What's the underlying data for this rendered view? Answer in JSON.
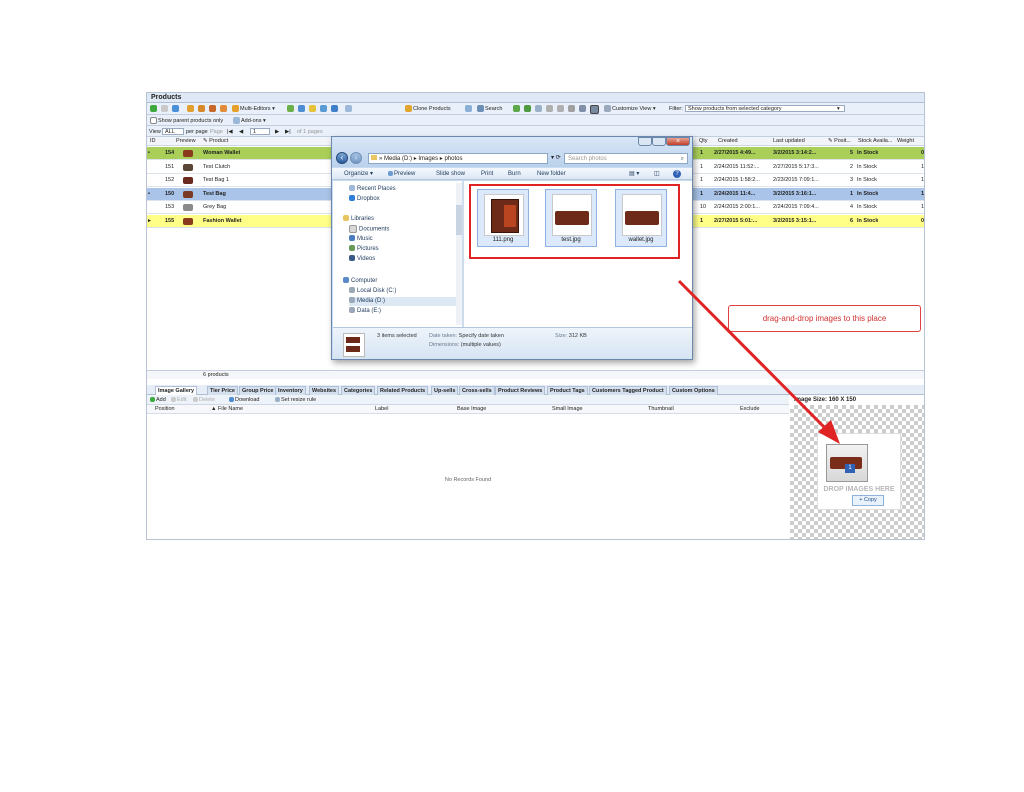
{
  "app": {
    "title": "Products",
    "toolbar1": {
      "multi_editors": "Multi-Editors",
      "clone_products": "Clone Products",
      "search": "Search",
      "customize_view": "Customize View",
      "filter_label": "Filter:",
      "filter_value": "Show products from selected category"
    },
    "toolbar2": {
      "show_parent": "Show parent products only",
      "addons": "Add-ons"
    },
    "toolbar3": {
      "view_label": "View",
      "view_value": "ALL",
      "per_page": "per page",
      "page_label": "Page",
      "page_value": "1",
      "of_pages": "of 1 pages"
    },
    "columns": {
      "id": "ID",
      "preview": "Preview",
      "product": "Product",
      "qty": "Qty",
      "created": "Created",
      "last_updated": "Last updated",
      "position": "Posit...",
      "stock": "Stock Availa...",
      "weight": "Weight"
    },
    "rows": [
      {
        "id": "154",
        "name": "Woman Wallet",
        "qty": "1",
        "created": "2/27/2015 4:49...",
        "updated": "3/2/2015 3:14:2...",
        "pos": "5",
        "stock": "In Stock",
        "weight": "0",
        "kind": "parent",
        "thumb": "#8b3a1e"
      },
      {
        "id": "151",
        "name": "Test Clutch",
        "qty": "1",
        "created": "2/24/2015 11:52:...",
        "updated": "2/27/2015 5:17:3...",
        "pos": "2",
        "stock": "In Stock",
        "weight": "1",
        "kind": "child",
        "thumb": "#5a4636"
      },
      {
        "id": "152",
        "name": "Test Bag 1",
        "qty": "1",
        "created": "2/24/2015 1:58:2...",
        "updated": "2/23/2015 7:09:1...",
        "pos": "3",
        "stock": "In Stock",
        "weight": "1",
        "kind": "child",
        "thumb": "#6b2a20"
      },
      {
        "id": "150",
        "name": "Test Bag",
        "qty": "1",
        "created": "2/24/2015 11:4...",
        "updated": "3/2/2015 3:16:1...",
        "pos": "1",
        "stock": "In Stock",
        "weight": "1",
        "kind": "parent-blue",
        "thumb": "#7a3a25"
      },
      {
        "id": "153",
        "name": "Grey Bag",
        "qty": "10",
        "created": "2/24/2015 2:00:1...",
        "updated": "2/24/2015 7:09:4...",
        "pos": "4",
        "stock": "In Stock",
        "weight": "1",
        "kind": "child",
        "thumb": "#8a8a8a"
      },
      {
        "id": "155",
        "name": "Fashion Wallet",
        "qty": "1",
        "created": "2/27/2015 5:01:...",
        "updated": "3/2/2015 3:15:1...",
        "pos": "6",
        "stock": "In Stock",
        "weight": "0",
        "kind": "selected",
        "thumb": "#8b3a1e"
      }
    ],
    "status": "6 products",
    "tabs": [
      "Image Gallery",
      "Tier Price",
      "Group Price",
      "Inventory",
      "Websites",
      "Categories",
      "Related Products",
      "Up-sells",
      "Cross-sells",
      "Product Reviews",
      "Product Tags",
      "Customers Tagged Product",
      "Custom Options"
    ],
    "image_toolbar": {
      "add": "Add",
      "edit": "Edit",
      "delete": "Delete",
      "download": "Download",
      "resize": "Set resize rule"
    },
    "image_columns": [
      "Position",
      "File Name",
      "Label",
      "Base Image",
      "Small Image",
      "Thumbnail",
      "Exclude"
    ],
    "no_records": "No Records Found",
    "image_size": "Image Size: 160 X 150",
    "drop_text": "DROP IMAGES HERE",
    "drag_badge": "1",
    "copy_label": "+ Copy"
  },
  "explorer": {
    "address": [
      "Media (D:)",
      "Images",
      "photos"
    ],
    "search_placeholder": "Search photos",
    "commands": [
      "Organize",
      "Preview",
      "Slide show",
      "Print",
      "Burn",
      "New folder"
    ],
    "nav": {
      "favorites": [
        "Recent Places",
        "Dropbox"
      ],
      "libraries_label": "Libraries",
      "libraries": [
        "Documents",
        "Music",
        "Pictures",
        "Videos"
      ],
      "computer_label": "Computer",
      "drives": [
        "Local Disk (C:)",
        "Media (D:)",
        "Data (E:)"
      ]
    },
    "files": [
      {
        "name": "111.png"
      },
      {
        "name": "test.jpg"
      },
      {
        "name": "wallet.jpg"
      }
    ],
    "details": {
      "selected": "3 items selected",
      "date_key": "Date taken:",
      "date_val": "Specify date taken",
      "size_key": "Size:",
      "size_val": "312 KB",
      "dim_key": "Dimensions:",
      "dim_val": "(multiple values)"
    }
  },
  "callout": "drag-and-drop images to this place",
  "colors": {
    "parent_green": "#a9cf58",
    "parent_blue": "#a9c4e8",
    "selected_yellow": "#ffff88",
    "highlight_red": "#e02424"
  }
}
